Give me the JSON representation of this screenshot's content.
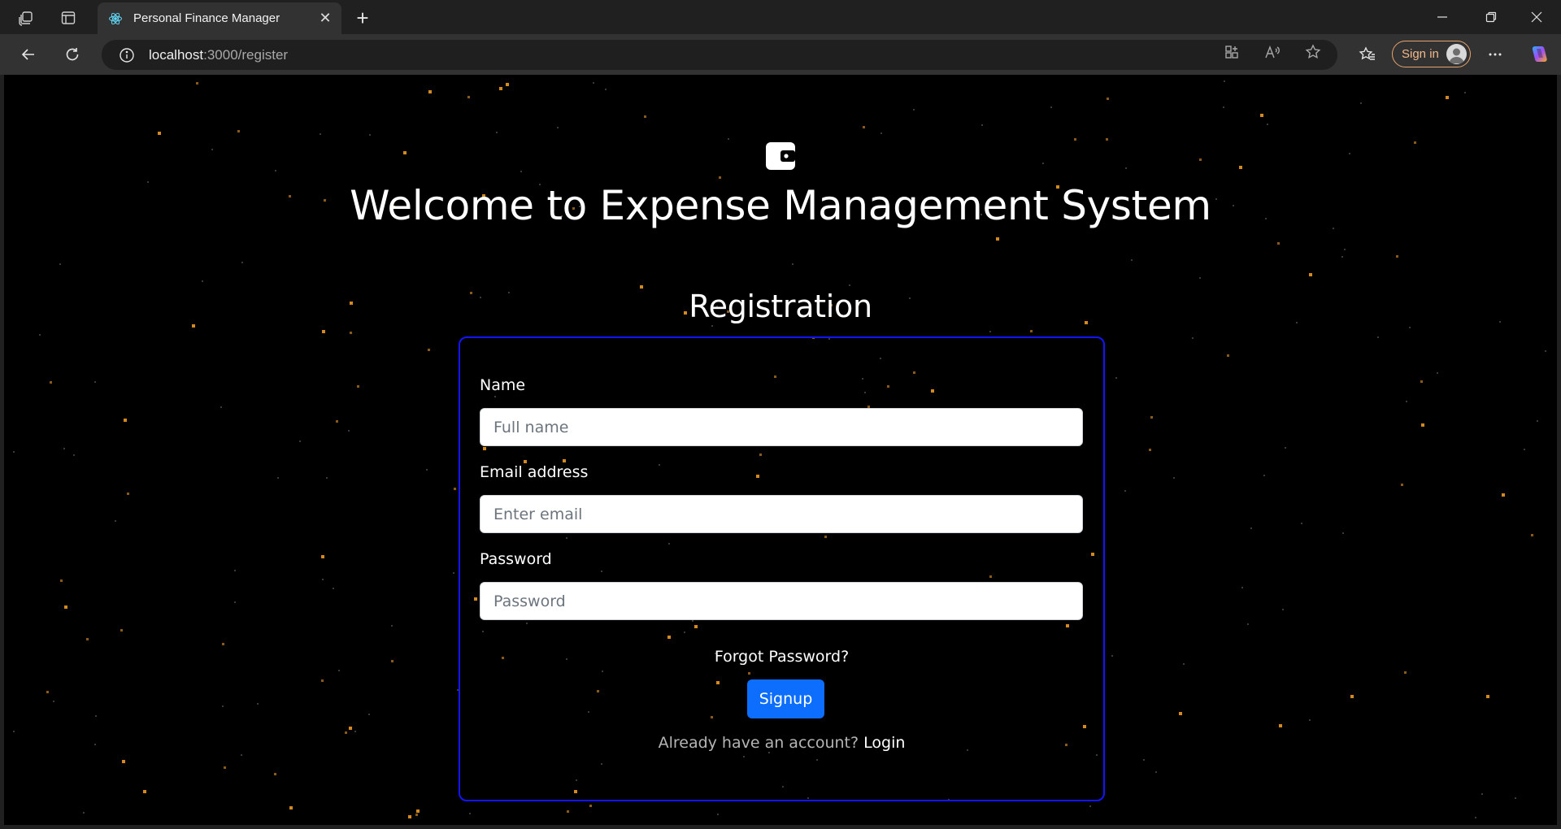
{
  "browser": {
    "tab_title": "Personal Finance Manager",
    "url_host": "localhost",
    "url_rest": ":3000/register",
    "signin_label": "Sign in",
    "accent_color": "#e7a46b"
  },
  "page": {
    "brand_icon": "wallet-icon",
    "welcome_title": "Welcome to Expense Management System",
    "form_title": "Registration",
    "fields": [
      {
        "label": "Name",
        "placeholder": "Full name",
        "value": ""
      },
      {
        "label": "Email address",
        "placeholder": "Enter email",
        "value": ""
      },
      {
        "label": "Password",
        "placeholder": "Password",
        "value": ""
      }
    ],
    "forgot_password": "Forgot Password?",
    "signup_label": "Signup",
    "already_text": "Already have an account?",
    "login_label": "Login",
    "colors": {
      "background": "#000000",
      "card_border": "#1414ff",
      "primary_button": "#0d6efd",
      "star": "#d4891f"
    }
  }
}
